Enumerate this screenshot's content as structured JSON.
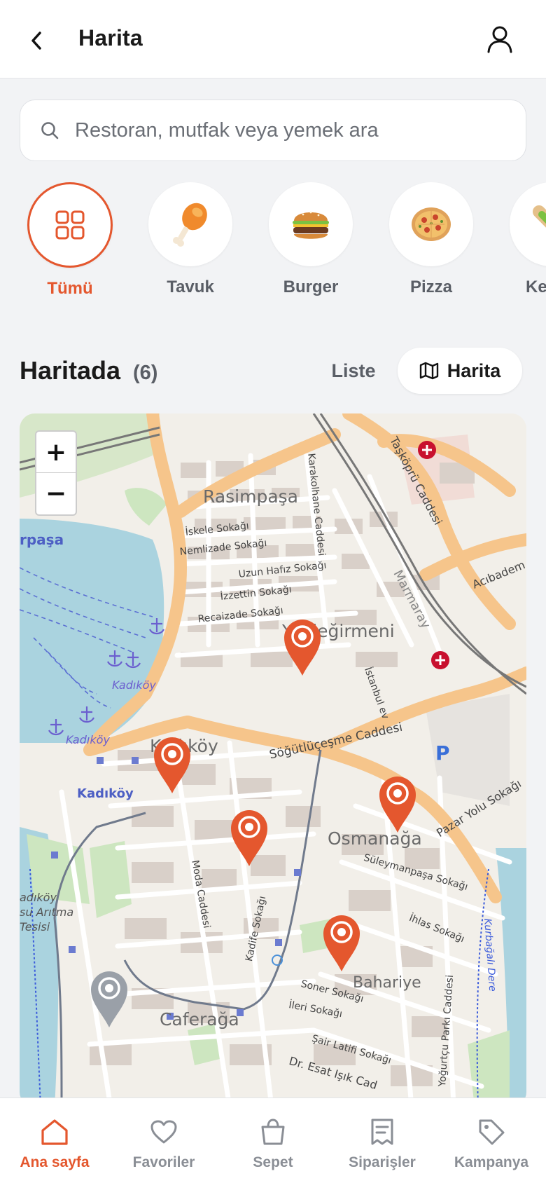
{
  "header": {
    "title": "Harita"
  },
  "search": {
    "placeholder": "Restoran, mutfak veya yemek ara"
  },
  "categories": [
    {
      "label": "Tümü",
      "active": true
    },
    {
      "label": "Tavuk",
      "active": false
    },
    {
      "label": "Burger",
      "active": false
    },
    {
      "label": "Pizza",
      "active": false
    },
    {
      "label": "Ke",
      "active": false
    }
  ],
  "section": {
    "title": "Haritada",
    "count": "(6)",
    "toggle_list": "Liste",
    "toggle_map": "Harita"
  },
  "map": {
    "zoom_in": "+",
    "zoom_out": "−",
    "labels": {
      "rasimpasa": "Rasimpaşa",
      "yeldegirmeni": "Yeldeğirmeni",
      "kadikoy": "Kadıköy",
      "osmanaga": "Osmanağa",
      "caferaga": "Caferağa",
      "bahariye": "Bahariye",
      "rpasa": "rpaşa",
      "kadikoy_pier1": "Kadıköy",
      "kadikoy_pier2": "Kadıköy",
      "kadikoy_station": "Kadıköy",
      "aritma": "adıköy\nsu Arıtma\nTesisi",
      "sogutlucesme": "Söğütlüçeşme Caddesi",
      "pazar_yolu": "Pazar Yolu Sokağı",
      "acibadem": "Acıbadem C",
      "taskopru": "Taşköprü Caddesi",
      "karakolhane": "Karakolhane Caddesi",
      "iskele": "İskele Sokağı",
      "nemlizade": "Nemlizade Sokağı",
      "uzun_hafiz": "Uzun Hafız Sokağı",
      "izzettin": "İzzettin Sokağı",
      "recaizade": "Recaizade Sokağı",
      "suleymanpasa": "Süleymanpaşa Sokağı",
      "moda": "Moda Caddesi",
      "kadife": "Kadife Sokağı",
      "soner": "Soner Sokağı",
      "ileri": "İleri Sokağı",
      "sair_latifi": "Şair Latifi Sokağı",
      "dr_esat": "Dr. Esat Işık Cad",
      "yogurtcu": "Yoğurtçu Parkı Caddesi",
      "ihlas": "İhlas Sokağı",
      "istanbul_ev": "İstanbul ev",
      "marmaray": "Marmaray",
      "kurbagalidere": "Kurbağalı Dere",
      "parking": "P"
    }
  },
  "nav": [
    {
      "label": "Ana sayfa",
      "icon": "home-icon",
      "active": true
    },
    {
      "label": "Favoriler",
      "icon": "heart-icon",
      "active": false
    },
    {
      "label": "Sepet",
      "icon": "bag-icon",
      "active": false
    },
    {
      "label": "Siparişler",
      "icon": "receipt-icon",
      "active": false
    },
    {
      "label": "Kampanya",
      "icon": "tag-icon",
      "active": false
    }
  ],
  "colors": {
    "accent": "#e4572e",
    "marker_inactive": "#9aa0a8",
    "road_major": "#f6c58b",
    "water": "#aad3df"
  }
}
